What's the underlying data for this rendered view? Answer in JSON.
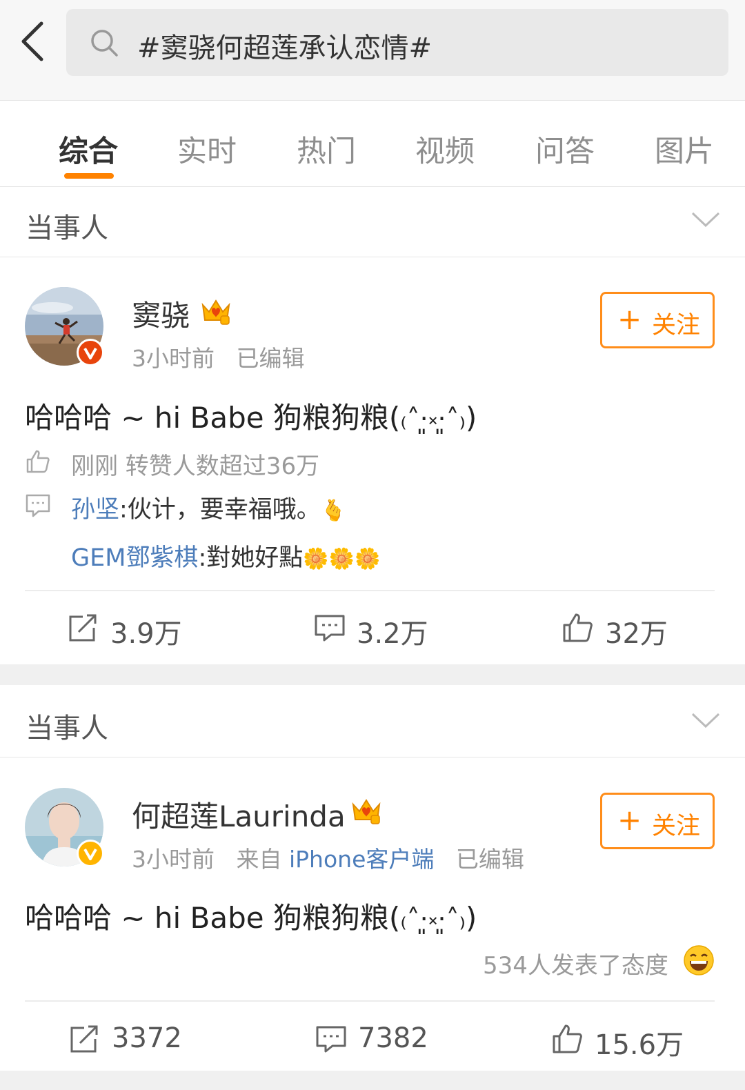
{
  "search": {
    "query": "#窦骁何超莲承认恋情#"
  },
  "tabs": [
    "综合",
    "实时",
    "热门",
    "视频",
    "问答",
    "图片"
  ],
  "sections": [
    {
      "header": "当事人",
      "user": {
        "name": "窦骁",
        "badge": "V",
        "badge_color": "#e8440c"
      },
      "time": "3小时前",
      "edited": "已编辑",
      "follow": {
        "plus": "+",
        "label": "关注"
      },
      "text": "哈哈哈 ~ hi Babe 狗粮狗粮(",
      "text_emoji": "₍˄·͈༝·͈˄₎",
      "text_end": ")",
      "interaction": "刚刚 转赞人数超过36万",
      "comments": [
        {
          "name": "孙坚",
          "text": ":伙计，要幸福哦。",
          "glyph": "🫰"
        },
        {
          "name": "GEM鄧紫棋",
          "text": ":對她好點",
          "glyph": "🌼🌼🌼"
        }
      ],
      "actions": {
        "repost": "3.9万",
        "comment": "3.2万",
        "like": "32万"
      }
    },
    {
      "header": "当事人",
      "user": {
        "name": "何超莲Laurinda",
        "badge": "V",
        "badge_color": "#ffb400"
      },
      "time": "3小时前",
      "source_prefix": "来自",
      "source": "iPhone客户端",
      "edited": "已编辑",
      "follow": {
        "plus": "+",
        "label": "关注"
      },
      "text": "哈哈哈 ~ hi Babe 狗粮狗粮(",
      "text_emoji": "₍˄·͈༝·͈˄₎",
      "text_end": ")",
      "reactions": "534人发表了态度",
      "actions": {
        "repost": "3372",
        "comment": "7382",
        "like": "15.6万"
      }
    }
  ],
  "colors": {
    "accent": "#ff8200",
    "link": "#4d7dba",
    "verified_red": "#e8440c",
    "verified_yellow": "#ffb400"
  }
}
